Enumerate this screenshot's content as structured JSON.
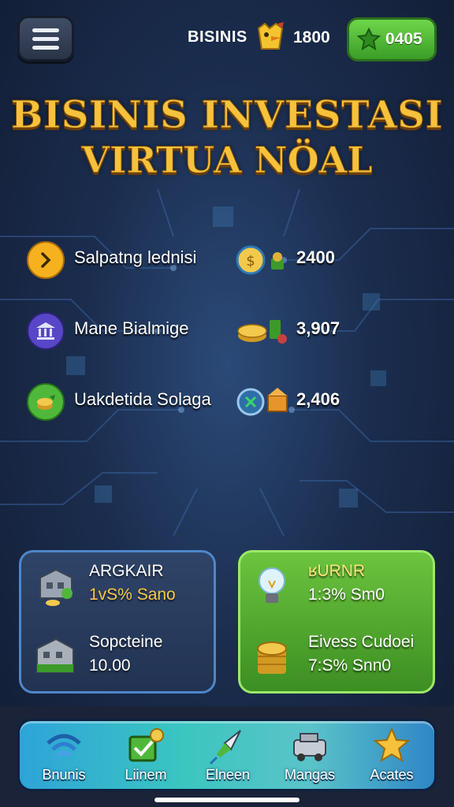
{
  "header": {
    "brand": "BISINIS",
    "coins": "1800",
    "gems": "0405"
  },
  "title": {
    "line1": "BISINIS INVESTASI",
    "line2": "VIRTUA NÖAL"
  },
  "investments": [
    {
      "label": "Salpatng lednisi",
      "value": "2400",
      "icon": "arrow-right-icon"
    },
    {
      "label": "Mane Bialmige",
      "value": "3,907",
      "icon": "bank-icon"
    },
    {
      "label": "Uakdetida Solaga",
      "value": "2,406",
      "icon": "coin-stack-icon"
    }
  ],
  "panel_left": {
    "items": [
      {
        "title": "ARGKAIR",
        "sub": "1vS% Sano"
      },
      {
        "title": "Sopcteine",
        "sub": "10.00"
      }
    ]
  },
  "panel_right": {
    "items": [
      {
        "title": "ʁURNR",
        "sub": "1:3% Sm0"
      },
      {
        "title": "Eivess Cudoei",
        "sub": "7:S% Snn0"
      }
    ]
  },
  "nav": [
    {
      "label": "Bnunis",
      "icon": "wifi-icon"
    },
    {
      "label": "Liinem",
      "icon": "checkbox-icon"
    },
    {
      "label": "Elneen",
      "icon": "rocket-icon"
    },
    {
      "label": "Mangas",
      "icon": "car-icon"
    },
    {
      "label": "Acates",
      "icon": "star-icon"
    }
  ],
  "colors": {
    "title_gold": "#f6c23c",
    "accent_green": "#5fbf3a",
    "panel_blue": "#2f4468",
    "nav_teal": "#3bc6c0"
  }
}
